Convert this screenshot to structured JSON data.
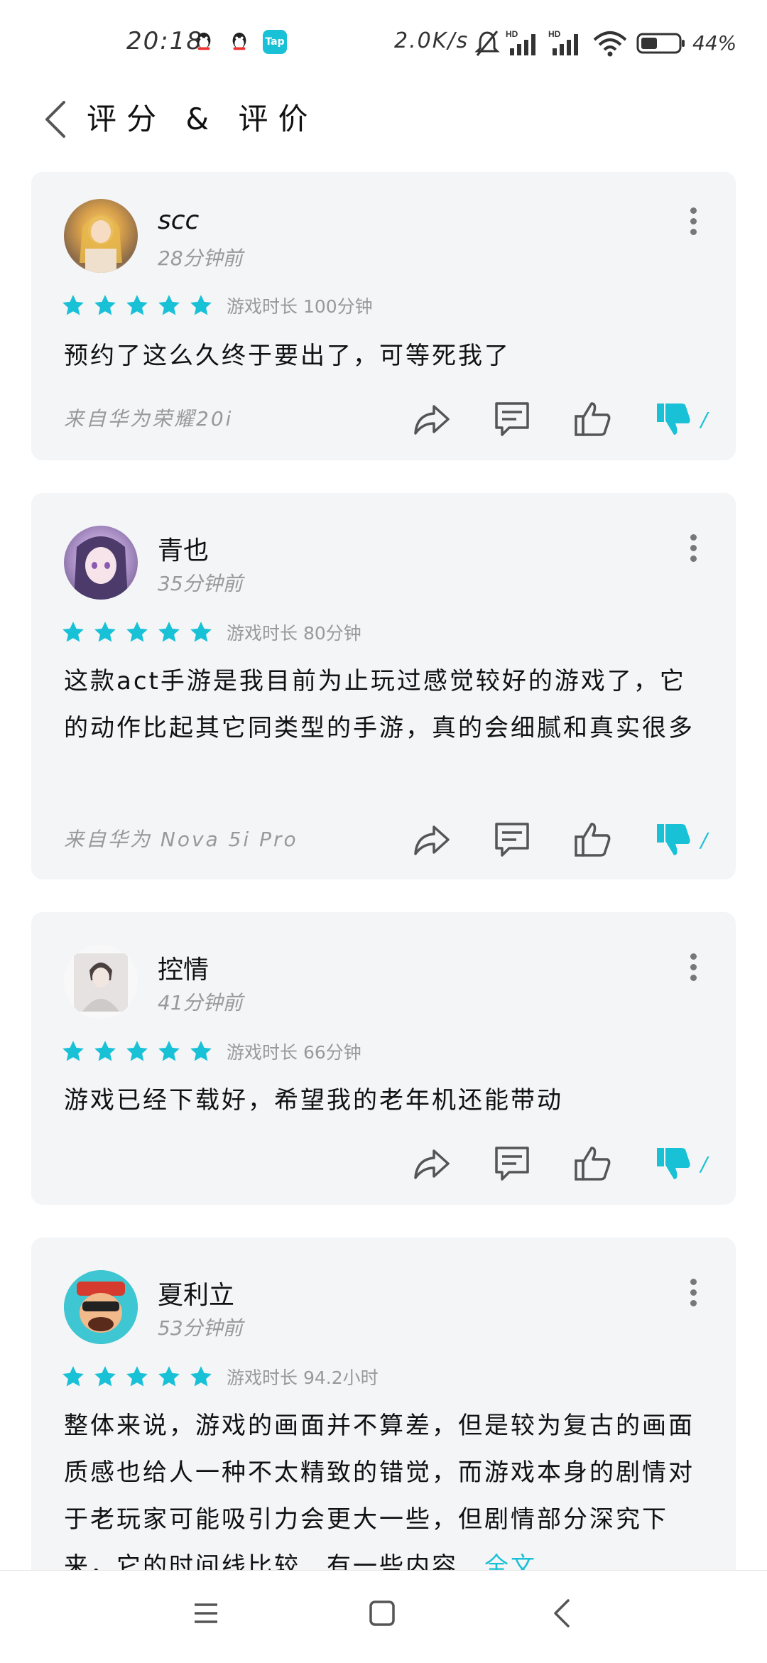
{
  "status_bar": {
    "time": "20:18",
    "net_speed": "2.0K/s",
    "battery": "44%",
    "tap_badge": "Tap"
  },
  "header": {
    "title": "评分 & 评价"
  },
  "reviews": [
    {
      "name": "scc",
      "time": "28分钟前",
      "stars": 5,
      "playtime": "游戏时长 100分钟",
      "content": "预约了这么久终于要出了，可等死我了",
      "device": "来自华为荣耀20i",
      "dislikes": "/"
    },
    {
      "name": "青也",
      "time": "35分钟前",
      "stars": 5,
      "playtime": "游戏时长 80分钟",
      "content": "这款act手游是我目前为止玩过感觉较好的游戏了，它的动作比起其它同类型的手游，真的会细腻和真实很多",
      "device": "来自华为 Nova 5i Pro",
      "dislikes": "/"
    },
    {
      "name": "控情",
      "time": "41分钟前",
      "stars": 5,
      "playtime": "游戏时长 66分钟",
      "content": "游戏已经下载好，希望我的老年机还能带动",
      "device": "",
      "dislikes": "/"
    },
    {
      "name": "夏利立",
      "time": "53分钟前",
      "stars": 5,
      "playtime": "游戏时长 94.2小时",
      "content": "整体来说，游戏的画面并不算差，但是较为复古的画面质感也给人一种不太精致的错觉，而游戏本身的剧情对于老玩家可能吸引力会更大一些，但剧情部分深究下来，它的时间线比较…有一些内容…",
      "more_label": "全文"
    }
  ],
  "colors": {
    "accent": "#19c1d6",
    "card_bg": "#f4f5f7"
  }
}
